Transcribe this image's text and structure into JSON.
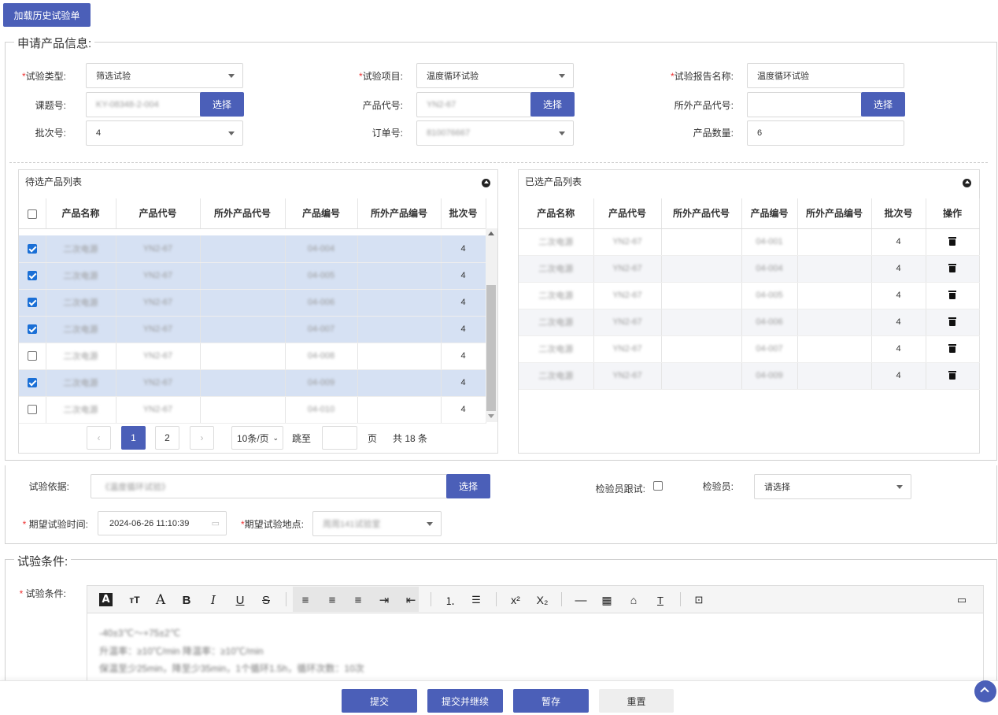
{
  "top_button": "加载历史试验单",
  "section1": {
    "legend": "申请产品信息:",
    "test_type_label": "试验类型:",
    "test_type_value": "筛选试验",
    "test_item_label": "试验项目:",
    "test_item_value": "温度循环试验",
    "report_name_label": "试验报告名称:",
    "report_name_value": "温度循环试验",
    "project_no_label": "课题号:",
    "project_no_value": "KY-08348-2-004",
    "product_code_label": "产品代号:",
    "product_code_value": "YN2-67",
    "ext_code_label": "所外产品代号:",
    "ext_code_value": "",
    "select_label": "选择",
    "batch_label": "批次号:",
    "batch_value": "4",
    "order_label": "订单号:",
    "order_value": "810076667",
    "qty_label": "产品数量:",
    "qty_value": "6"
  },
  "left_table": {
    "title": "待选产品列表",
    "headers": [
      "产品名称",
      "产品代号",
      "所外产品代号",
      "产品编号",
      "所外产品编号",
      "批次号"
    ],
    "rows": [
      {
        "checked": true,
        "name": "二次电源",
        "code": "YN2-67",
        "ext": "",
        "no": "04-004",
        "extno": "",
        "batch": "4"
      },
      {
        "checked": true,
        "name": "二次电源",
        "code": "YN2-67",
        "ext": "",
        "no": "04-005",
        "extno": "",
        "batch": "4"
      },
      {
        "checked": true,
        "name": "二次电源",
        "code": "YN2-67",
        "ext": "",
        "no": "04-006",
        "extno": "",
        "batch": "4"
      },
      {
        "checked": true,
        "name": "二次电源",
        "code": "YN2-67",
        "ext": "",
        "no": "04-007",
        "extno": "",
        "batch": "4"
      },
      {
        "checked": false,
        "name": "二次电源",
        "code": "YN2-67",
        "ext": "",
        "no": "04-008",
        "extno": "",
        "batch": "4"
      },
      {
        "checked": true,
        "name": "二次电源",
        "code": "YN2-67",
        "ext": "",
        "no": "04-009",
        "extno": "",
        "batch": "4"
      },
      {
        "checked": false,
        "name": "二次电源",
        "code": "YN2-67",
        "ext": "",
        "no": "04-010",
        "extno": "",
        "batch": "4"
      }
    ],
    "pagination": {
      "prev": "‹",
      "next": "›",
      "page1": "1",
      "page2": "2",
      "page_size": "10条/页",
      "jump_label": "跳至",
      "page_unit": "页",
      "total": "共 18 条"
    }
  },
  "right_table": {
    "title": "已选产品列表",
    "headers": [
      "产品名称",
      "产品代号",
      "所外产品代号",
      "产品编号",
      "所外产品编号",
      "批次号",
      "操作"
    ],
    "rows": [
      {
        "name": "二次电源",
        "code": "YN2-67",
        "ext": "",
        "no": "04-001",
        "extno": "",
        "batch": "4"
      },
      {
        "name": "二次电源",
        "code": "YN2-67",
        "ext": "",
        "no": "04-004",
        "extno": "",
        "batch": "4"
      },
      {
        "name": "二次电源",
        "code": "YN2-67",
        "ext": "",
        "no": "04-005",
        "extno": "",
        "batch": "4"
      },
      {
        "name": "二次电源",
        "code": "YN2-67",
        "ext": "",
        "no": "04-006",
        "extno": "",
        "batch": "4"
      },
      {
        "name": "二次电源",
        "code": "YN2-67",
        "ext": "",
        "no": "04-007",
        "extno": "",
        "batch": "4"
      },
      {
        "name": "二次电源",
        "code": "YN2-67",
        "ext": "",
        "no": "04-009",
        "extno": "",
        "batch": "4"
      }
    ]
  },
  "basis": {
    "label": "试验依据:",
    "value": "《温度循环试验》",
    "select": "选择",
    "inspector_follow_label": "检验员跟试:",
    "inspector_label": "检验员:",
    "inspector_placeholder": "请选择",
    "time_label": "期望试验时间:",
    "time_value": "2024-06-26 11:10:39",
    "place_label": "期望试验地点:",
    "place_value": "周周141试验室"
  },
  "conditions": {
    "legend": "试验条件:",
    "label": "试验条件:",
    "lines": [
      "-40±3℃～+75±2℃",
      "升温率：≥10℃/min 降温率：≥10℃/min",
      "保温至少25min，降至少35min，1个循环1.5h，循环次数：10次"
    ]
  },
  "footer": {
    "submit": "提交",
    "submit_continue": "提交并继续",
    "save_draft": "暂存",
    "reset": "重置"
  }
}
